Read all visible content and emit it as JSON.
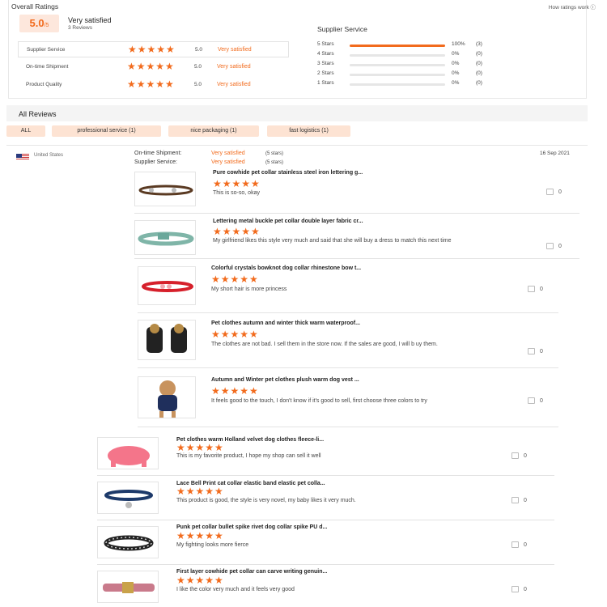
{
  "overall": {
    "title": "Overall Ratings",
    "how_link": "How ratings work ⓘ",
    "score": "5.0",
    "score_suffix": "/5",
    "label": "Very satisfied",
    "count": "3 Reviews",
    "metrics": [
      {
        "label": "Supplier Service",
        "stars": "★★★★★",
        "score": "5.0",
        "verdict": "Very satisfied"
      },
      {
        "label": "On-time Shipment",
        "stars": "★★★★★",
        "score": "5.0",
        "verdict": "Very satisfied"
      },
      {
        "label": "Product Quality",
        "stars": "★★★★★",
        "score": "5.0",
        "verdict": "Very satisfied"
      }
    ]
  },
  "supplier_service": {
    "title": "Supplier Service",
    "rows": [
      {
        "label": "5 Stars",
        "fill": 1.0,
        "pct": "100%",
        "count": "(3)"
      },
      {
        "label": "4 Stars",
        "fill": 0,
        "pct": "0%",
        "count": "(0)"
      },
      {
        "label": "3 Stars",
        "fill": 0,
        "pct": "0%",
        "count": "(0)"
      },
      {
        "label": "2 Stars",
        "fill": 0,
        "pct": "0%",
        "count": "(0)"
      },
      {
        "label": "1 Stars",
        "fill": 0,
        "pct": "0%",
        "count": "(0)"
      }
    ]
  },
  "reviews": {
    "title": "All Reviews",
    "filters": [
      "ALL",
      "professional service (1)",
      "nice packaging (1)",
      "fast logistics (1)"
    ],
    "review": {
      "country": "United States",
      "shipment_label": "On-time Shipment:",
      "shipment_value": "Very satisfied",
      "shipment_stars": "(5 stars)",
      "service_label": "Supplier Service:",
      "service_value": "Very satisfied",
      "service_stars": "(5 stars)",
      "date": "16 Sep 2021"
    },
    "items": [
      {
        "title": "Pure cowhide pet collar stainless steel iron lettering g...",
        "stars": "★★★★★",
        "text": "This is so-so, okay",
        "likes": "0"
      },
      {
        "title": "Lettering metal buckle pet collar double layer fabric cr...",
        "stars": "★★★★★",
        "text": "My girlfriend likes this style very much and said that she will buy a dress to match this next time",
        "likes": "0"
      },
      {
        "title": "Colorful crystals bowknot dog collar rhinestone bow t...",
        "stars": "★★★★★",
        "text": "My short hair is more princess",
        "likes": "0"
      },
      {
        "title": "Pet clothes autumn and winter thick warm waterproof...",
        "stars": "★★★★★",
        "text": "The clothes are not bad. I sell them in the store now. If the sales are good, I will b uy them.",
        "likes": "0"
      },
      {
        "title": "Autumn and Winter pet clothes plush warm dog vest ...",
        "stars": "★★★★★",
        "text": "It feels good to the touch, I don't know if it's good to sell, first choose three colors to try",
        "likes": "0"
      },
      {
        "title": "Pet clothes warm Holland velvet dog clothes fleece-li...",
        "stars": "★★★★★",
        "text": "This is my favorite product, I hope my shop can sell it well",
        "likes": "0"
      },
      {
        "title": "Lace Bell Print cat collar elastic band elastic pet colla...",
        "stars": "★★★★★",
        "text": "This product is good, the style is very novel, my baby likes it very much.",
        "likes": "0"
      },
      {
        "title": "Punk pet collar bullet spike rivet dog collar spike PU d...",
        "stars": "★★★★★",
        "text": "My fighting looks more fierce",
        "likes": "0"
      },
      {
        "title": "First layer cowhide pet collar can carve writing genuin...",
        "stars": "★★★★★",
        "text": "I like the color very much and it feels very good",
        "likes": "0"
      }
    ]
  }
}
